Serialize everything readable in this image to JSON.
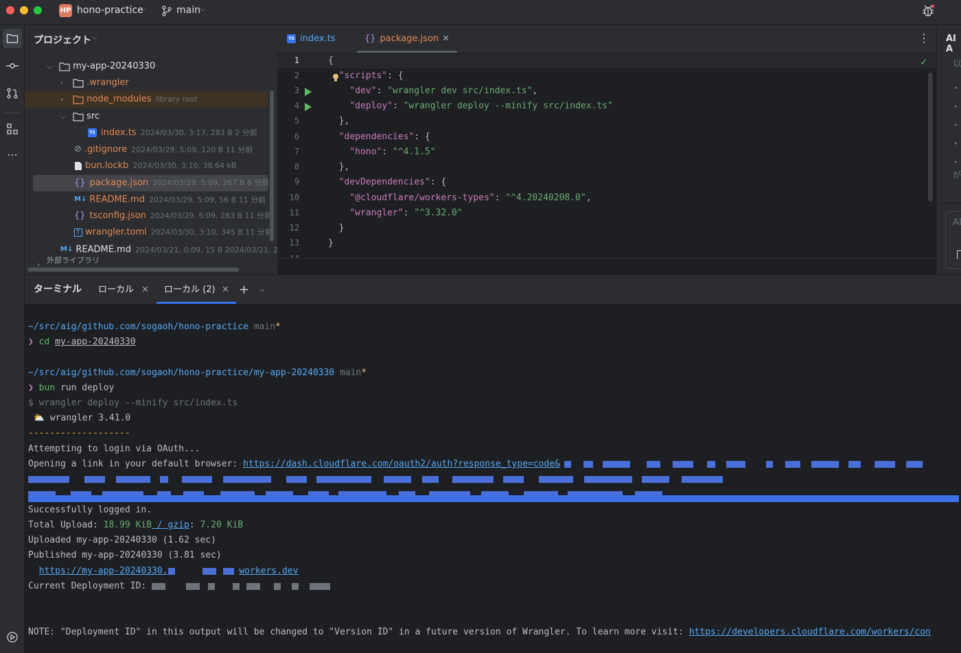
{
  "titlebar": {
    "project_badge": "HP",
    "project_name": "hono-practice",
    "branch": "main"
  },
  "project_pane": {
    "title": "プロジェクト",
    "items": [
      {
        "label": "my-app-20240330",
        "meta": ""
      },
      {
        "label": ".wrangler",
        "meta": ""
      },
      {
        "label": "node_modules",
        "meta": "library root"
      },
      {
        "label": "src",
        "meta": ""
      },
      {
        "label": "index.ts",
        "meta": "2024/03/30, 3:17, 283 B 2 分前"
      },
      {
        "label": ".gitignore",
        "meta": "2024/03/29, 5:09, 120 B 11 分前"
      },
      {
        "label": "bun.lockb",
        "meta": "2024/03/30, 3:10, 38.64 kB"
      },
      {
        "label": "package.json",
        "meta": "2024/03/29, 5:09, 267 B 8 分前"
      },
      {
        "label": "README.md",
        "meta": "2024/03/29, 5:09, 56 B 11 分前"
      },
      {
        "label": "tsconfig.json",
        "meta": "2024/03/29, 5:09, 283 B 11 分前"
      },
      {
        "label": "wrangler.toml",
        "meta": "2024/03/30, 3:10, 345 B 11 分前"
      },
      {
        "label": "README.md",
        "meta": "2024/03/21, 0:09, 15 B 2024/03/21, 2"
      },
      {
        "label": "外部ライブラリ",
        "meta": ""
      }
    ]
  },
  "editor": {
    "tabs": [
      {
        "label": "index.ts"
      },
      {
        "label": "package.json"
      }
    ],
    "line_numbers": [
      "1",
      "2",
      "3",
      "4",
      "5",
      "6",
      "7",
      "8",
      "9",
      "10",
      "11",
      "12",
      "13",
      "14"
    ]
  },
  "ai_panel": {
    "title": "AI A",
    "jp_text": "以",
    "jp_text2": "が",
    "input_label": "AI"
  },
  "terminal": {
    "title": "ターミナル",
    "tabs": [
      {
        "label": "ローカル"
      },
      {
        "label": "ローカル (2)"
      }
    ],
    "lines": {
      "path1": "~/src/aig/github.com/sogaoh/hono-practice",
      "branch": "main",
      "star": "*",
      "prompt": "❯",
      "cd_cmd": "cd",
      "cd_arg": "my-app-20240330",
      "path2": "~/src/aig/github.com/sogaoh/hono-practice/my-app-20240330",
      "bun_cmd": "bun",
      "bun_args": " run deploy",
      "dollar_line": "$ wrangler deploy --minify src/index.ts",
      "wrangler_ver": " ⛅️ wrangler 3.41.0",
      "dashes": "-------------------",
      "login_try": "Attempting to login via OAuth...",
      "opening": "Opening a link in your default browser: ",
      "oauth_link": "https://dash.cloudflare.com/oauth2/auth?response_type=code&",
      "logged_in": "Successfully logged in.",
      "upload_label": "Total Upload: ",
      "upload_size": "18.99 KiB",
      "gzip_sep": " / gzip",
      "gzip_colon": ": ",
      "gzip_size": "7.20 KiB",
      "uploaded": "Uploaded my-app-20240330 (1.62 sec)",
      "published": "Published my-app-20240330 (3.81 sec)",
      "url_prefix": "https://my-app-20240330.",
      "url_suffix": "workers.dev",
      "deploy_id": "Current Deployment ID: ",
      "note": "NOTE: \"Deployment ID\" in this output will be changed to \"Version ID\" in a future version of Wrangler. To learn more visit: ",
      "note_link": "https://developers.cloudflare.com/workers/con"
    }
  },
  "colors": {
    "accent": "#3574f0",
    "string": "#6aab73",
    "key": "#c77dbb",
    "path": "#56a8f5",
    "orange": "#e08855"
  }
}
